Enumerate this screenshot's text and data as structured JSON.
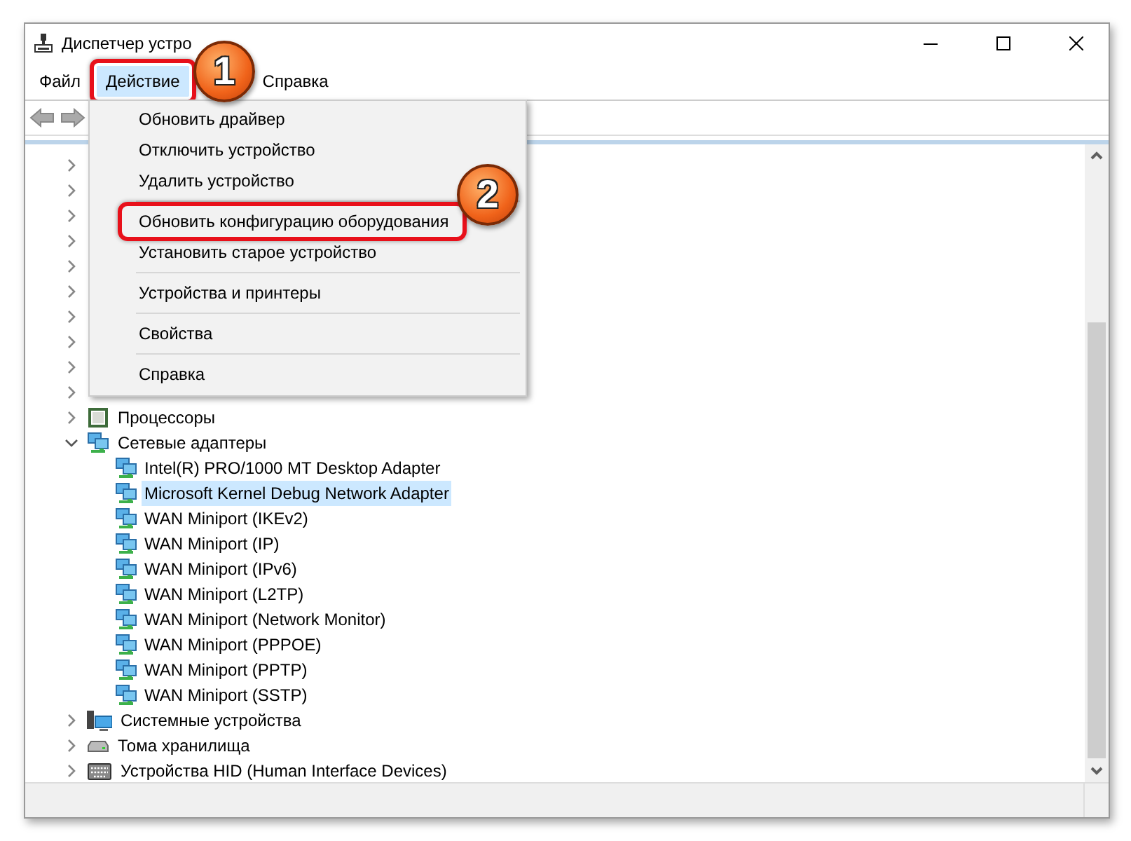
{
  "window": {
    "title": "Диспетчер устро"
  },
  "menu_bar": [
    {
      "label": "Файл",
      "selected": false,
      "annotated": false
    },
    {
      "label": "Действие",
      "selected": true,
      "annotated": true
    },
    {
      "label": "Справка",
      "selected": false,
      "annotated": false
    }
  ],
  "tree": [
    {
      "kind": "hidden",
      "expanded": false
    },
    {
      "kind": "hidden",
      "expanded": false
    },
    {
      "kind": "hidden",
      "expanded": false
    },
    {
      "kind": "hidden",
      "expanded": false
    },
    {
      "kind": "hidden",
      "expanded": false
    },
    {
      "kind": "hidden",
      "expanded": false
    },
    {
      "kind": "hidden",
      "expanded": false
    },
    {
      "kind": "hidden",
      "expanded": false
    },
    {
      "kind": "hidden",
      "expanded": false
    },
    {
      "kind": "hidden",
      "expanded": false
    },
    {
      "kind": "processor",
      "label": "Процессоры",
      "expanded": false
    },
    {
      "kind": "network",
      "label": "Сетевые адаптеры",
      "expanded": true,
      "children": [
        {
          "label": "Intel(R) PRO/1000 MT Desktop Adapter",
          "selected": false
        },
        {
          "label": "Microsoft Kernel Debug Network Adapter",
          "selected": true
        },
        {
          "label": "WAN Miniport (IKEv2)",
          "selected": false
        },
        {
          "label": "WAN Miniport (IP)",
          "selected": false
        },
        {
          "label": "WAN Miniport (IPv6)",
          "selected": false
        },
        {
          "label": "WAN Miniport (L2TP)",
          "selected": false
        },
        {
          "label": "WAN Miniport (Network Monitor)",
          "selected": false
        },
        {
          "label": "WAN Miniport (PPPOE)",
          "selected": false
        },
        {
          "label": "WAN Miniport (PPTP)",
          "selected": false
        },
        {
          "label": "WAN Miniport (SSTP)",
          "selected": false
        }
      ]
    },
    {
      "kind": "system",
      "label": "Системные устройства",
      "expanded": false
    },
    {
      "kind": "storage",
      "label": "Тома хранилища",
      "expanded": false
    },
    {
      "kind": "hid",
      "label": "Устройства HID (Human Interface Devices)",
      "expanded": false
    }
  ],
  "context_menu": [
    {
      "kind": "item",
      "label": "Обновить драйвер",
      "annotated": false
    },
    {
      "kind": "item",
      "label": "Отключить устройство",
      "annotated": false
    },
    {
      "kind": "item",
      "label": "Удалить устройство",
      "annotated": false
    },
    {
      "kind": "separator"
    },
    {
      "kind": "item",
      "label": "Обновить конфигурацию оборудования",
      "annotated": true
    },
    {
      "kind": "item",
      "label": "Установить старое устройство",
      "annotated": false
    },
    {
      "kind": "separator"
    },
    {
      "kind": "item",
      "label": "Устройства и принтеры",
      "annotated": false
    },
    {
      "kind": "separator"
    },
    {
      "kind": "item",
      "label": "Свойства",
      "annotated": false
    },
    {
      "kind": "separator"
    },
    {
      "kind": "item",
      "label": "Справка",
      "annotated": false
    }
  ],
  "annotations": [
    {
      "label": "1"
    },
    {
      "label": "2"
    }
  ]
}
